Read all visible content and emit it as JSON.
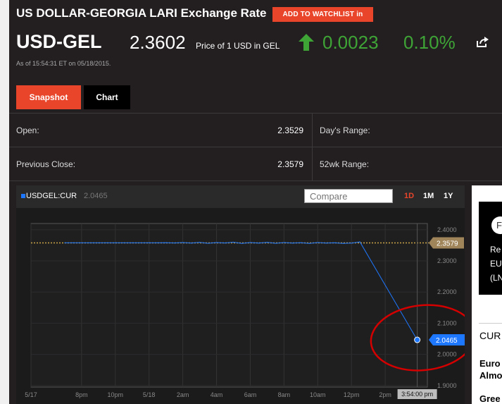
{
  "header": {
    "title": "US DOLLAR-GEORGIA LARI Exchange Rate",
    "watchlist_button": "ADD TO WATCHLIST in"
  },
  "quote": {
    "ticker": "USD-GEL",
    "price": "2.3602",
    "price_unit": "Price of 1 USD in GEL",
    "change": "0.0023",
    "change_pct": "0.10%",
    "direction": "up",
    "as_of": "As of 15:54:31 ET on 05/18/2015."
  },
  "tabs": {
    "snapshot": "Snapshot",
    "chart": "Chart"
  },
  "stats": {
    "open_label": "Open:",
    "open_value": "2.3529",
    "prev_close_label": "Previous Close:",
    "prev_close_value": "2.3579",
    "days_range_label": "Day's Range:",
    "wk52_range_label": "52wk Range:"
  },
  "chart_header": {
    "series_name": "USDGEL:CUR",
    "series_value": "2.0465",
    "compare_placeholder": "Compare",
    "ranges": [
      "1D",
      "1M",
      "1Y"
    ],
    "active_range": "1D"
  },
  "chart_data": {
    "type": "line",
    "x_labels": [
      "5/17",
      "8pm",
      "10pm",
      "5/18",
      "2am",
      "4am",
      "6am",
      "8am",
      "10am",
      "12pm",
      "2pm"
    ],
    "y_ticks": [
      "2.4000",
      "2.3000",
      "2.2000",
      "2.1000",
      "2.0000",
      "1.9000"
    ],
    "ylim": [
      1.9,
      2.4
    ],
    "previous_close": 2.3579,
    "previous_close_label": "2.3579",
    "last_value_label": "2.0465",
    "crosshair_time": "3:54:00 pm",
    "series": [
      {
        "name": "USDGEL:CUR",
        "x": [
          "19:00",
          "19:30",
          "20:00",
          "20:30",
          "21:00",
          "21:30",
          "22:00",
          "22:30",
          "23:00",
          "23:30",
          "00:00",
          "00:30",
          "01:00",
          "01:30",
          "02:00",
          "02:30",
          "03:00",
          "03:30",
          "04:00",
          "04:30",
          "05:00",
          "05:30",
          "06:00",
          "06:30",
          "07:00",
          "07:30",
          "08:00",
          "08:30",
          "09:00",
          "09:30",
          "10:00",
          "10:30",
          "11:00",
          "11:30",
          "12:00",
          "12:30",
          "15:54"
        ],
        "values": [
          2.3579,
          2.3579,
          2.3579,
          2.3579,
          2.3579,
          2.3579,
          2.3579,
          2.3579,
          2.3579,
          2.3579,
          2.3579,
          2.3579,
          2.3585,
          2.3575,
          2.359,
          2.357,
          2.3595,
          2.3565,
          2.359,
          2.3575,
          2.36,
          2.356,
          2.359,
          2.357,
          2.3595,
          2.3565,
          2.359,
          2.357,
          2.3585,
          2.356,
          2.359,
          2.357,
          2.358,
          2.356,
          2.357,
          2.361,
          2.0465
        ]
      }
    ],
    "colors": {
      "line": "#1e78ff",
      "previous_close": "#c9a54a",
      "annotation": "#d40000"
    }
  },
  "sidebar": {
    "promo_badge": "F",
    "promo_line1": "Re",
    "promo_line2": "EU",
    "promo_line3": "(LN",
    "section_label": "CUR",
    "item1_line1": "Euro",
    "item1_line2": "Almo",
    "item2": "Gree"
  }
}
